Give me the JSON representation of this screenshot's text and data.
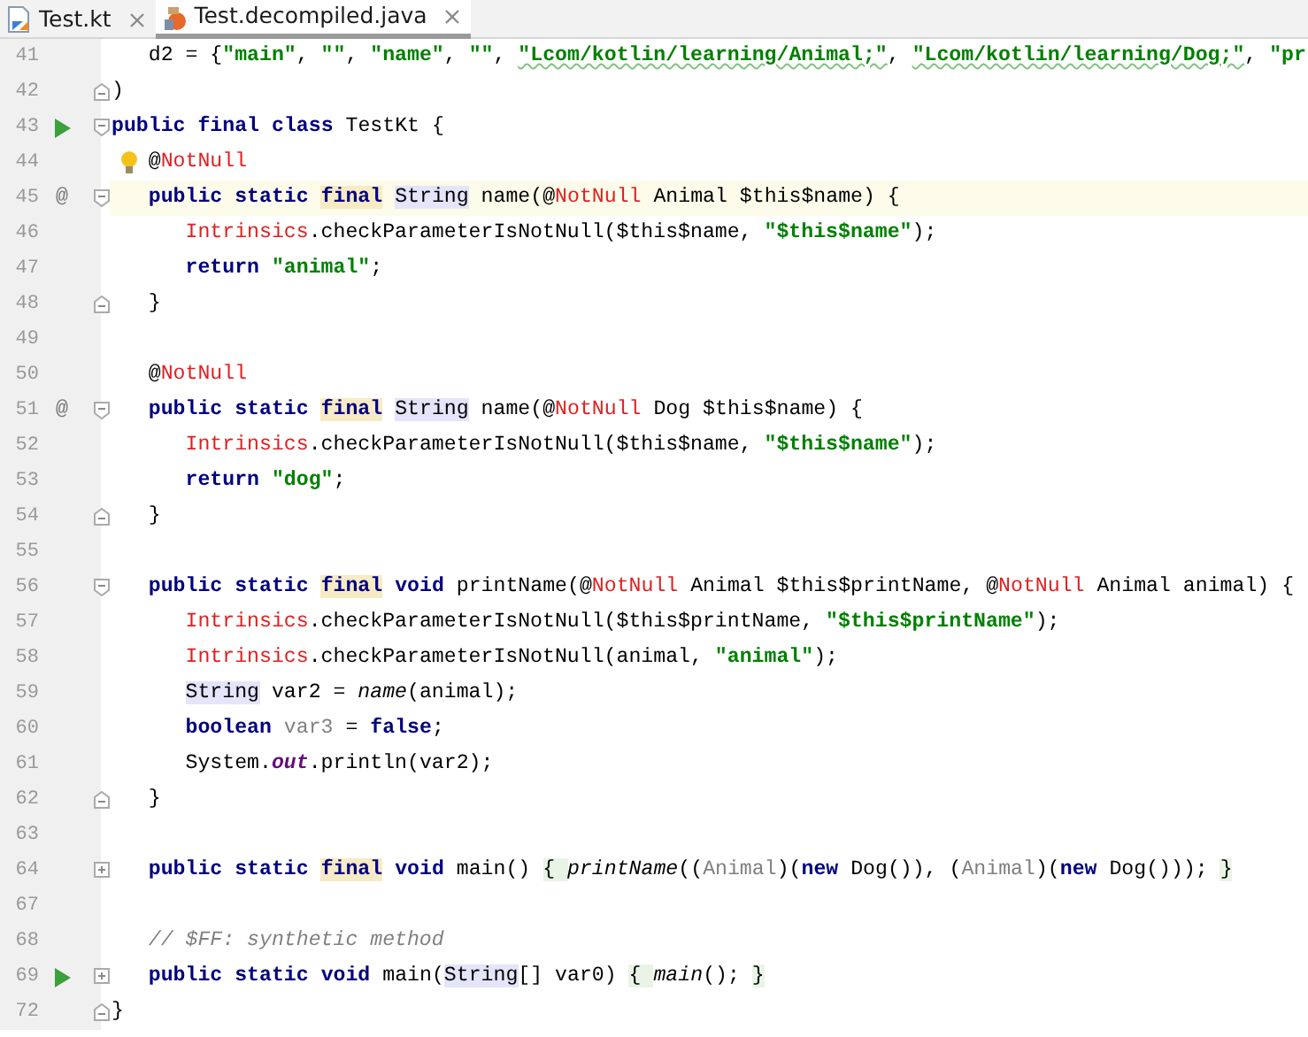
{
  "tabs": [
    {
      "label": "Test.kt",
      "kind": "kotlin",
      "selected": false
    },
    {
      "label": "Test.decompiled.java",
      "kind": "java",
      "selected": true
    }
  ],
  "lines": [
    {
      "number": "41",
      "tokens": [
        {
          "text": "   d2 = {",
          "kind": "plain"
        },
        {
          "text": "\"main\"",
          "kind": "string"
        },
        {
          "text": ", ",
          "kind": "plain"
        },
        {
          "text": "\"\"",
          "kind": "string"
        },
        {
          "text": ", ",
          "kind": "plain"
        },
        {
          "text": "\"name\"",
          "kind": "string"
        },
        {
          "text": ", ",
          "kind": "plain"
        },
        {
          "text": "\"\"",
          "kind": "string"
        },
        {
          "text": ", ",
          "kind": "plain"
        },
        {
          "text": "\"Lcom/kotlin/learning/Animal;\"",
          "kind": "string",
          "typo": true
        },
        {
          "text": ", ",
          "kind": "plain"
        },
        {
          "text": "\"Lcom/kotlin/learning/Dog;\"",
          "kind": "string",
          "typo": true
        },
        {
          "text": ", ",
          "kind": "plain"
        },
        {
          "text": "\"pr",
          "kind": "string"
        }
      ]
    },
    {
      "number": "42",
      "fold_end": true,
      "tokens": [
        {
          "text": ")",
          "kind": "plain"
        }
      ]
    },
    {
      "number": "43",
      "runnable": true,
      "fold_start": true,
      "tokens": [
        {
          "text": "public",
          "kind": "keyword"
        },
        {
          "text": " final",
          "kind": "keyword"
        },
        {
          "text": " class",
          "kind": "keyword"
        },
        {
          "text": " TestKt {",
          "kind": "plain"
        }
      ]
    },
    {
      "number": "44",
      "intention": true,
      "tokens": [
        {
          "text": "   @",
          "kind": "plain"
        },
        {
          "text": "NotNull",
          "kind": "error"
        }
      ]
    },
    {
      "number": "45",
      "gutter_text": "@",
      "fold_start": true,
      "current": true,
      "tokens": [
        {
          "text": "   public",
          "kind": "keyword"
        },
        {
          "text": " static",
          "kind": "keyword"
        },
        {
          "text": " final",
          "kind": "keyword",
          "warning": true
        },
        {
          "text": " String",
          "kind": "plain",
          "usage": true
        },
        {
          "text": " name(@",
          "kind": "plain"
        },
        {
          "text": "NotNull",
          "kind": "error"
        },
        {
          "text": " Animal $this$name) {",
          "kind": "plain"
        }
      ]
    },
    {
      "number": "46",
      "tokens": [
        {
          "text": "      Intrinsics",
          "kind": "error"
        },
        {
          "text": ".checkParameterIsNotNull($this$name, ",
          "kind": "plain"
        },
        {
          "text": "\"$this$name\"",
          "kind": "string"
        },
        {
          "text": ");",
          "kind": "plain"
        }
      ]
    },
    {
      "number": "47",
      "tokens": [
        {
          "text": "      return",
          "kind": "keyword"
        },
        {
          "text": " \"animal\"",
          "kind": "string"
        },
        {
          "text": ";",
          "kind": "plain"
        }
      ]
    },
    {
      "number": "48",
      "fold_end": true,
      "tokens": [
        {
          "text": "   }",
          "kind": "plain"
        }
      ]
    },
    {
      "number": "49"
    },
    {
      "number": "50",
      "tokens": [
        {
          "text": "   @",
          "kind": "plain"
        },
        {
          "text": "NotNull",
          "kind": "error"
        }
      ]
    },
    {
      "number": "51",
      "gutter_text": "@",
      "fold_start": true,
      "tokens": [
        {
          "text": "   public",
          "kind": "keyword"
        },
        {
          "text": " static",
          "kind": "keyword"
        },
        {
          "text": " final",
          "kind": "keyword",
          "warning": true
        },
        {
          "text": " String",
          "kind": "plain",
          "usage": true
        },
        {
          "text": " name(@",
          "kind": "plain"
        },
        {
          "text": "NotNull",
          "kind": "error"
        },
        {
          "text": " Dog $this$name) {",
          "kind": "plain"
        }
      ]
    },
    {
      "number": "52",
      "tokens": [
        {
          "text": "      Intrinsics",
          "kind": "error"
        },
        {
          "text": ".checkParameterIsNotNull($this$name, ",
          "kind": "plain"
        },
        {
          "text": "\"$this$name\"",
          "kind": "string"
        },
        {
          "text": ");",
          "kind": "plain"
        }
      ]
    },
    {
      "number": "53",
      "tokens": [
        {
          "text": "      return",
          "kind": "keyword"
        },
        {
          "text": " \"dog\"",
          "kind": "string"
        },
        {
          "text": ";",
          "kind": "plain"
        }
      ]
    },
    {
      "number": "54",
      "fold_end": true,
      "tokens": [
        {
          "text": "   }",
          "kind": "plain"
        }
      ]
    },
    {
      "number": "55"
    },
    {
      "number": "56",
      "fold_start": true,
      "tokens": [
        {
          "text": "   public",
          "kind": "keyword"
        },
        {
          "text": " static",
          "kind": "keyword"
        },
        {
          "text": " final",
          "kind": "keyword",
          "warning": true
        },
        {
          "text": " void",
          "kind": "keyword"
        },
        {
          "text": " printName(@",
          "kind": "plain"
        },
        {
          "text": "NotNull",
          "kind": "error"
        },
        {
          "text": " Animal $this$printName, @",
          "kind": "plain"
        },
        {
          "text": "NotNull",
          "kind": "error"
        },
        {
          "text": " Animal animal) {",
          "kind": "plain"
        }
      ]
    },
    {
      "number": "57",
      "tokens": [
        {
          "text": "      Intrinsics",
          "kind": "error"
        },
        {
          "text": ".checkParameterIsNotNull($this$printName, ",
          "kind": "plain"
        },
        {
          "text": "\"$this$printName\"",
          "kind": "string"
        },
        {
          "text": ");",
          "kind": "plain"
        }
      ]
    },
    {
      "number": "58",
      "tokens": [
        {
          "text": "      Intrinsics",
          "kind": "error"
        },
        {
          "text": ".checkParameterIsNotNull(animal, ",
          "kind": "plain"
        },
        {
          "text": "\"animal\"",
          "kind": "string"
        },
        {
          "text": ");",
          "kind": "plain"
        }
      ]
    },
    {
      "number": "59",
      "tokens": [
        {
          "text": "      String",
          "kind": "plain",
          "usage": true
        },
        {
          "text": " var2 = ",
          "kind": "plain"
        },
        {
          "text": "name",
          "kind": "static-call"
        },
        {
          "text": "(animal);",
          "kind": "plain"
        }
      ]
    },
    {
      "number": "60",
      "tokens": [
        {
          "text": "      boolean",
          "kind": "keyword"
        },
        {
          "text": " var3",
          "kind": "unused"
        },
        {
          "text": " = ",
          "kind": "plain"
        },
        {
          "text": "false",
          "kind": "keyword"
        },
        {
          "text": ";",
          "kind": "plain"
        }
      ]
    },
    {
      "number": "61",
      "tokens": [
        {
          "text": "      System.",
          "kind": "plain"
        },
        {
          "text": "out",
          "kind": "static-field"
        },
        {
          "text": ".println(var2);",
          "kind": "plain"
        }
      ]
    },
    {
      "number": "62",
      "fold_end": true,
      "tokens": [
        {
          "text": "   }",
          "kind": "plain"
        }
      ]
    },
    {
      "number": "63"
    },
    {
      "number": "64",
      "folded": true,
      "tokens": [
        {
          "text": "   public",
          "kind": "keyword"
        },
        {
          "text": " static",
          "kind": "keyword"
        },
        {
          "text": " final",
          "kind": "keyword",
          "warning": true
        },
        {
          "text": " void",
          "kind": "keyword"
        },
        {
          "text": " main() ",
          "kind": "plain"
        },
        {
          "text": "{ ",
          "kind": "plain",
          "fold_region": true
        },
        {
          "text": "printName",
          "kind": "static-call"
        },
        {
          "text": "((",
          "kind": "plain"
        },
        {
          "text": "Animal",
          "kind": "unused"
        },
        {
          "text": ")(",
          "kind": "plain"
        },
        {
          "text": "new",
          "kind": "keyword"
        },
        {
          "text": " Dog()), (",
          "kind": "plain"
        },
        {
          "text": "Animal",
          "kind": "unused"
        },
        {
          "text": ")(",
          "kind": "plain"
        },
        {
          "text": "new",
          "kind": "keyword"
        },
        {
          "text": " Dog()));",
          "kind": "plain"
        },
        {
          "text": " }",
          "kind": "plain",
          "fold_region": true
        }
      ]
    },
    {
      "number": "67"
    },
    {
      "number": "68",
      "tokens": [
        {
          "text": "   // $FF: synthetic method",
          "kind": "comment"
        }
      ]
    },
    {
      "number": "69",
      "runnable": true,
      "folded": true,
      "tokens": [
        {
          "text": "   public",
          "kind": "keyword"
        },
        {
          "text": " static",
          "kind": "keyword"
        },
        {
          "text": " void",
          "kind": "keyword"
        },
        {
          "text": " main(",
          "kind": "plain"
        },
        {
          "text": "String",
          "kind": "plain",
          "usage": true
        },
        {
          "text": "[] var0) ",
          "kind": "plain"
        },
        {
          "text": "{ ",
          "kind": "plain",
          "fold_region": true
        },
        {
          "text": "main",
          "kind": "static-call"
        },
        {
          "text": "();",
          "kind": "plain"
        },
        {
          "text": " }",
          "kind": "plain",
          "fold_region": true
        }
      ]
    },
    {
      "number": "72",
      "fold_end": true,
      "tokens": [
        {
          "text": "}",
          "kind": "plain"
        }
      ]
    }
  ]
}
